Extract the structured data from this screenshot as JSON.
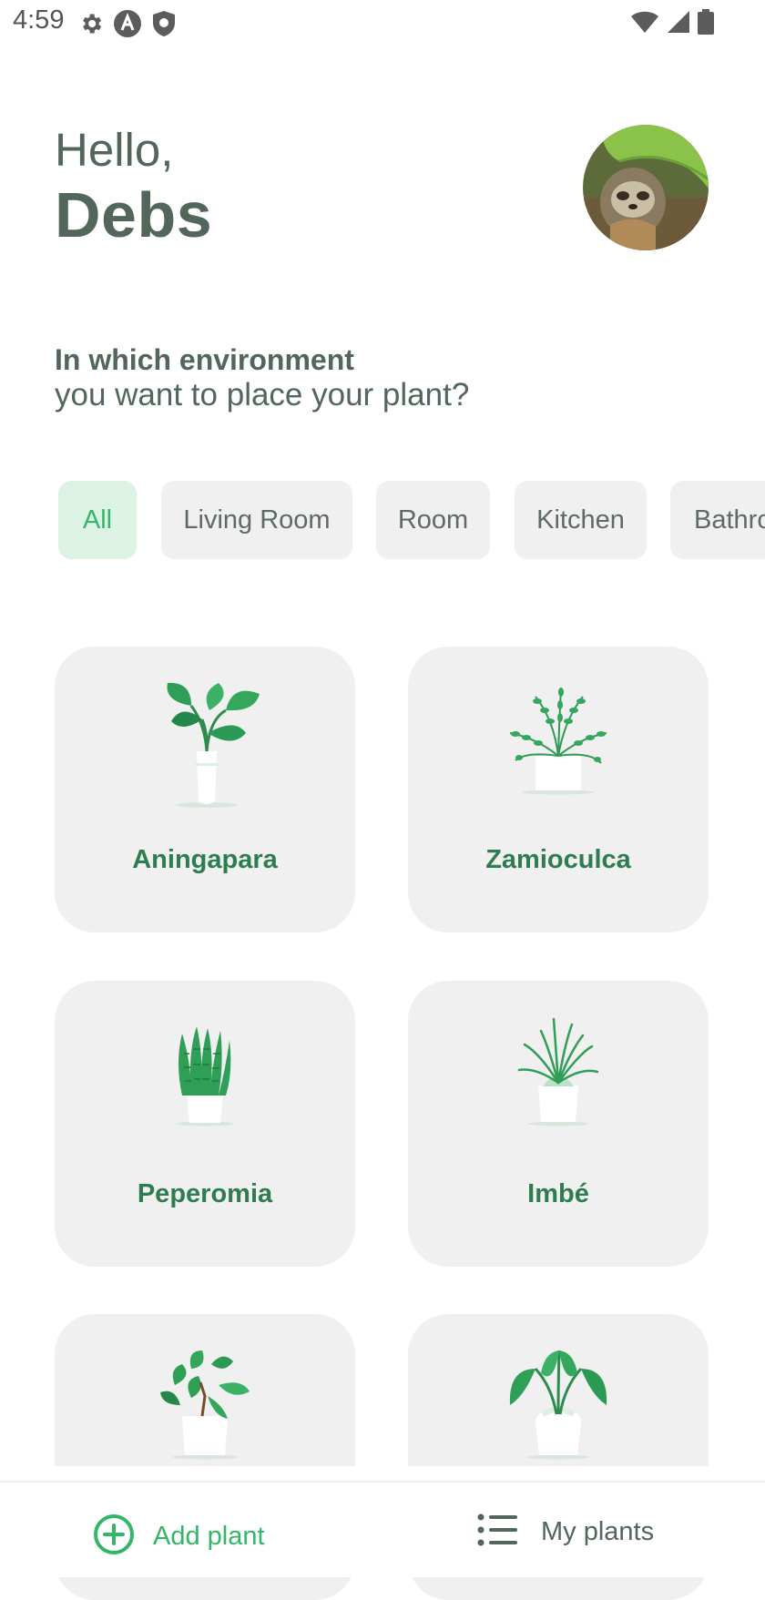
{
  "status_bar": {
    "time": "4:59",
    "left_icons": [
      "settings-icon",
      "a-icon",
      "shield-icon"
    ],
    "right_icons": [
      "wifi-icon",
      "signal-icon",
      "battery-icon"
    ]
  },
  "header": {
    "greeting": "Hello,",
    "user_name": "Debs",
    "avatar": "sloth-avatar"
  },
  "environment": {
    "title": "In which environment",
    "subtitle": "you want to place your plant?"
  },
  "filters": [
    {
      "label": "All",
      "active": true
    },
    {
      "label": "Living Room",
      "active": false
    },
    {
      "label": "Room",
      "active": false
    },
    {
      "label": "Kitchen",
      "active": false
    },
    {
      "label": "Bathroom",
      "active": false
    }
  ],
  "plants": [
    {
      "name": "Aningapara",
      "icon": "plant-broadleaf-icon"
    },
    {
      "name": "Zamioculca",
      "icon": "plant-fern-icon"
    },
    {
      "name": "Peperomia",
      "icon": "plant-snake-icon"
    },
    {
      "name": "Imbé",
      "icon": "plant-spider-icon"
    },
    {
      "name": "",
      "icon": "plant-pothos-icon"
    },
    {
      "name": "",
      "icon": "plant-alocasia-icon"
    }
  ],
  "bottom_nav": {
    "add_label": "Add plant",
    "my_plants_label": "My plants"
  },
  "colors": {
    "primary_green": "#32B768",
    "text_heading": "#52665A",
    "card_bg": "#F0F0F0",
    "chip_active_bg": "#DCF2E4",
    "plant_name": "#2E7D4F"
  }
}
